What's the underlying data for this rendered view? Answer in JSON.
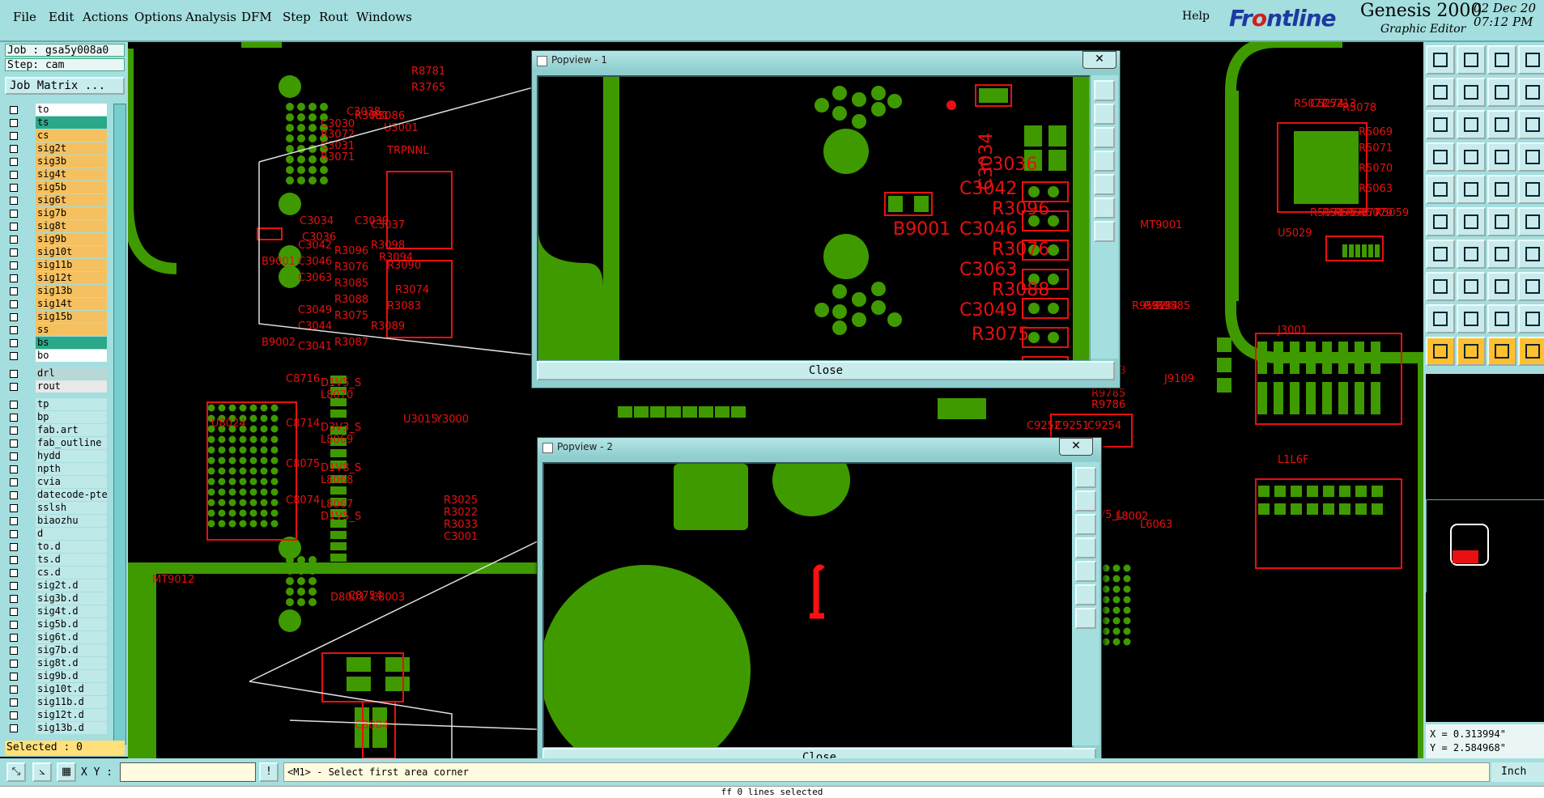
{
  "menu": {
    "items": [
      "File",
      "Edit",
      "Actions",
      "Options",
      "Analysis",
      "DFM",
      "Step",
      "Rout",
      "Windows"
    ],
    "help": "Help"
  },
  "brand": {
    "logo_a": "Fr",
    "logo_b": "o",
    "logo_c": "ntline",
    "title": "Genesis 2000",
    "subtitle": "Graphic Editor",
    "date": "02 Dec 20",
    "time": "07:12 PM"
  },
  "job": {
    "job_label": "Job : gsa5y008a0",
    "step_label": "Step: cam",
    "matrix_button": "Job Matrix ..."
  },
  "layers": {
    "board": [
      {
        "name": "to",
        "color": "#ffffff"
      },
      {
        "name": "ts",
        "color": "#2aa888"
      },
      {
        "name": "cs",
        "color": "#f5c060"
      },
      {
        "name": "sig2t",
        "color": "#f5c060"
      },
      {
        "name": "sig3b",
        "color": "#f5c060"
      },
      {
        "name": "sig4t",
        "color": "#f5c060"
      },
      {
        "name": "sig5b",
        "color": "#f5c060"
      },
      {
        "name": "sig6t",
        "color": "#f5c060"
      },
      {
        "name": "sig7b",
        "color": "#f5c060"
      },
      {
        "name": "sig8t",
        "color": "#f5c060"
      },
      {
        "name": "sig9b",
        "color": "#f5c060"
      },
      {
        "name": "sig10t",
        "color": "#f5c060"
      },
      {
        "name": "sig11b",
        "color": "#f5c060"
      },
      {
        "name": "sig12t",
        "color": "#f5c060"
      },
      {
        "name": "sig13b",
        "color": "#f5c060"
      },
      {
        "name": "sig14t",
        "color": "#f5c060"
      },
      {
        "name": "sig15b",
        "color": "#f5c060"
      },
      {
        "name": "ss",
        "color": "#f5c060"
      },
      {
        "name": "bs",
        "color": "#2aa888"
      },
      {
        "name": "bo",
        "color": "#ffffff"
      }
    ],
    "drill": [
      {
        "name": "drl",
        "color": "#b8d8d8"
      },
      {
        "name": "rout",
        "color": "#e8e8e8"
      }
    ],
    "misc": [
      {
        "name": "tp",
        "color": "#bfe8e8"
      },
      {
        "name": "bp",
        "color": "#bfe8e8"
      },
      {
        "name": "fab.art",
        "color": "#bfe8e8"
      },
      {
        "name": "fab_outline",
        "color": "#bfe8e8"
      },
      {
        "name": "hydd",
        "color": "#bfe8e8"
      },
      {
        "name": "npth",
        "color": "#bfe8e8"
      },
      {
        "name": "cvia",
        "color": "#bfe8e8"
      },
      {
        "name": "datecode-pte",
        "color": "#bfe8e8"
      },
      {
        "name": "sslsh",
        "color": "#bfe8e8"
      },
      {
        "name": "biaozhu",
        "color": "#bfe8e8"
      },
      {
        "name": "d",
        "color": "#bfe8e8"
      },
      {
        "name": "to.d",
        "color": "#bfe8e8"
      },
      {
        "name": "ts.d",
        "color": "#bfe8e8"
      },
      {
        "name": "cs.d",
        "color": "#bfe8e8"
      },
      {
        "name": "sig2t.d",
        "color": "#bfe8e8"
      },
      {
        "name": "sig3b.d",
        "color": "#bfe8e8"
      },
      {
        "name": "sig4t.d",
        "color": "#bfe8e8"
      },
      {
        "name": "sig5b.d",
        "color": "#bfe8e8"
      },
      {
        "name": "sig6t.d",
        "color": "#bfe8e8"
      },
      {
        "name": "sig7b.d",
        "color": "#bfe8e8"
      },
      {
        "name": "sig8t.d",
        "color": "#bfe8e8"
      },
      {
        "name": "sig9b.d",
        "color": "#bfe8e8"
      },
      {
        "name": "sig10t.d",
        "color": "#bfe8e8"
      },
      {
        "name": "sig11b.d",
        "color": "#bfe8e8"
      },
      {
        "name": "sig12t.d",
        "color": "#bfe8e8"
      },
      {
        "name": "sig13b.d",
        "color": "#bfe8e8"
      }
    ]
  },
  "selected": "Selected : 0",
  "bottom": {
    "xy_label": "X Y :",
    "xy_value": "",
    "prompt": "<M1> - Select first area corner",
    "units": "Inch",
    "status": "ff 0 lines selected"
  },
  "coords": {
    "x": "X = 0.313994\"",
    "y": "Y = 2.584968\""
  },
  "popup1": {
    "title": "Popview - 1",
    "close": "Close"
  },
  "popup2": {
    "title": "Popview - 2",
    "close": "Close"
  },
  "pcb_labels": [
    "C3030",
    "R3072",
    "C3031",
    "R3071",
    "C3038",
    "R3081",
    "R3086",
    "U3001",
    "C3034",
    "C3036",
    "C3039",
    "C3037",
    "C3042",
    "R3096",
    "C3046",
    "R3076",
    "C3063",
    "R3085",
    "R3088",
    "C3049",
    "R3075",
    "C3044",
    "R3089",
    "R3087",
    "C3041",
    "R3098",
    "R3094",
    "R3090",
    "R3074",
    "R3083",
    "B9001",
    "B9002",
    "TRPNNL",
    "C8716",
    "D1V5_S",
    "L8070",
    "C8714",
    "D3V3_S",
    "L8069",
    "C8075",
    "D1V8_S",
    "L8068",
    "C8074",
    "L8067",
    "D1V5_S",
    "U8024",
    "MT9012",
    "D8001",
    "C8754",
    "C8003",
    "C8004",
    "U3015",
    "Y3000",
    "R3025",
    "R3022",
    "R3033",
    "C3001",
    "R8781",
    "R3765",
    "C8795",
    "C8796",
    "MT9001",
    "R9582",
    "R9584",
    "R9585",
    "U9053",
    "J9109",
    "R9785",
    "R9786",
    "C9252",
    "C9251",
    "C9254",
    "J3001",
    "L1L6F",
    "D3V3_L",
    "D2V5_L",
    "L8002",
    "L6063",
    "C8023",
    "U5029",
    "R5072",
    "C5274",
    "C5213",
    "R5078",
    "R5069",
    "R5071",
    "R5070",
    "R5063",
    "R5074",
    "R5075",
    "R5076",
    "R5077",
    "R5079",
    "R5059"
  ],
  "popup1_labels": [
    "C3034",
    "C3036",
    "C3042",
    "R3096",
    "C3046",
    "R3076",
    "C3063",
    "R3088",
    "C3049",
    "B9001",
    "R3075"
  ],
  "colors": {
    "copper": "#3f9a00",
    "silk": "#e81010",
    "ui_teal": "#a4dede"
  }
}
